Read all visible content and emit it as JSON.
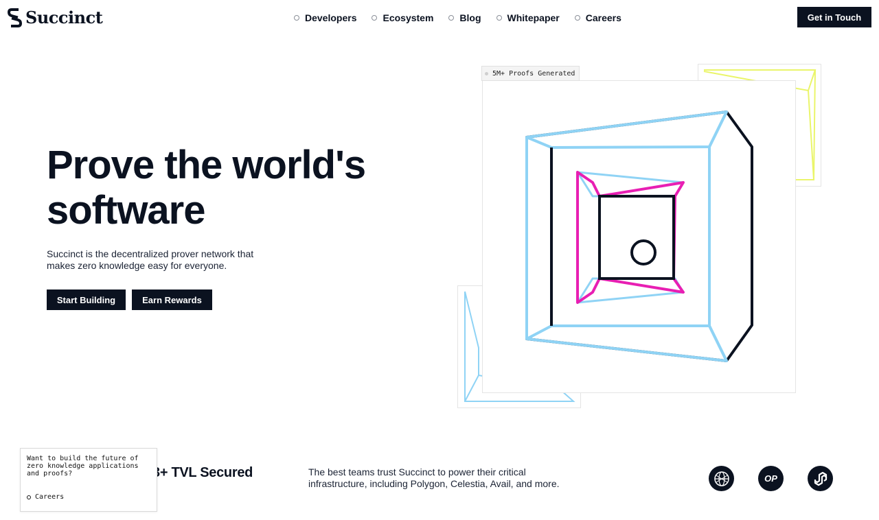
{
  "brand": {
    "name": "Succinct"
  },
  "nav": [
    {
      "label": "Developers"
    },
    {
      "label": "Ecosystem"
    },
    {
      "label": "Blog"
    },
    {
      "label": "Whitepaper"
    },
    {
      "label": "Careers"
    }
  ],
  "header": {
    "cta_label": "Get in Touch"
  },
  "hero": {
    "title": "Prove the world's\nsoftware",
    "subtitle": "Succinct is the decentralized prover network that makes zero knowledge easy for everyone.",
    "primary_button": "Start Building",
    "secondary_button": "Earn Rewards"
  },
  "illustration": {
    "badge": "5M+ Proofs Generated",
    "colors": {
      "blue": "#8fd3f5",
      "pink": "#e81fb3",
      "dark": "#0b1220",
      "yellow": "#eaf56a"
    }
  },
  "stats": {
    "tvl_fragment": "3+ TVL Secured"
  },
  "trust": {
    "text": "The best teams trust Succinct to power their critical infrastructure, including Polygon, Celestia, Avail, and more."
  },
  "partners": [
    {
      "icon": "globe-icon"
    },
    {
      "label": "OP"
    },
    {
      "icon": "polygon-icon"
    }
  ],
  "popup": {
    "text": "Want to build the future of zero knowledge applications and proofs?",
    "link_label": "Careers"
  }
}
